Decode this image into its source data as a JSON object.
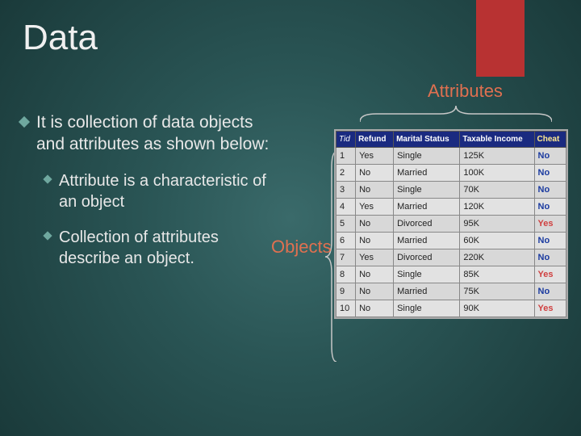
{
  "title": "Data",
  "labels": {
    "attributes": "Attributes",
    "objects": "Objects"
  },
  "bullets": {
    "main": "It is collection of data objects and attributes as shown below:",
    "sub1_lead": "Attribute",
    "sub1_rest": " is a characteristic of an object",
    "sub2_lead": "Collection",
    "sub2_rest": " of attributes describe an object."
  },
  "table": {
    "headers": [
      "Tid",
      "Refund",
      "Marital Status",
      "Taxable Income",
      "Cheat"
    ],
    "rows": [
      {
        "tid": "1",
        "refund": "Yes",
        "marital": "Single",
        "income": "125K",
        "cheat": "No"
      },
      {
        "tid": "2",
        "refund": "No",
        "marital": "Married",
        "income": "100K",
        "cheat": "No"
      },
      {
        "tid": "3",
        "refund": "No",
        "marital": "Single",
        "income": "70K",
        "cheat": "No"
      },
      {
        "tid": "4",
        "refund": "Yes",
        "marital": "Married",
        "income": "120K",
        "cheat": "No"
      },
      {
        "tid": "5",
        "refund": "No",
        "marital": "Divorced",
        "income": "95K",
        "cheat": "Yes"
      },
      {
        "tid": "6",
        "refund": "No",
        "marital": "Married",
        "income": "60K",
        "cheat": "No"
      },
      {
        "tid": "7",
        "refund": "Yes",
        "marital": "Divorced",
        "income": "220K",
        "cheat": "No"
      },
      {
        "tid": "8",
        "refund": "No",
        "marital": "Single",
        "income": "85K",
        "cheat": "Yes"
      },
      {
        "tid": "9",
        "refund": "No",
        "marital": "Married",
        "income": "75K",
        "cheat": "No"
      },
      {
        "tid": "10",
        "refund": "No",
        "marital": "Single",
        "income": "90K",
        "cheat": "Yes"
      }
    ]
  }
}
